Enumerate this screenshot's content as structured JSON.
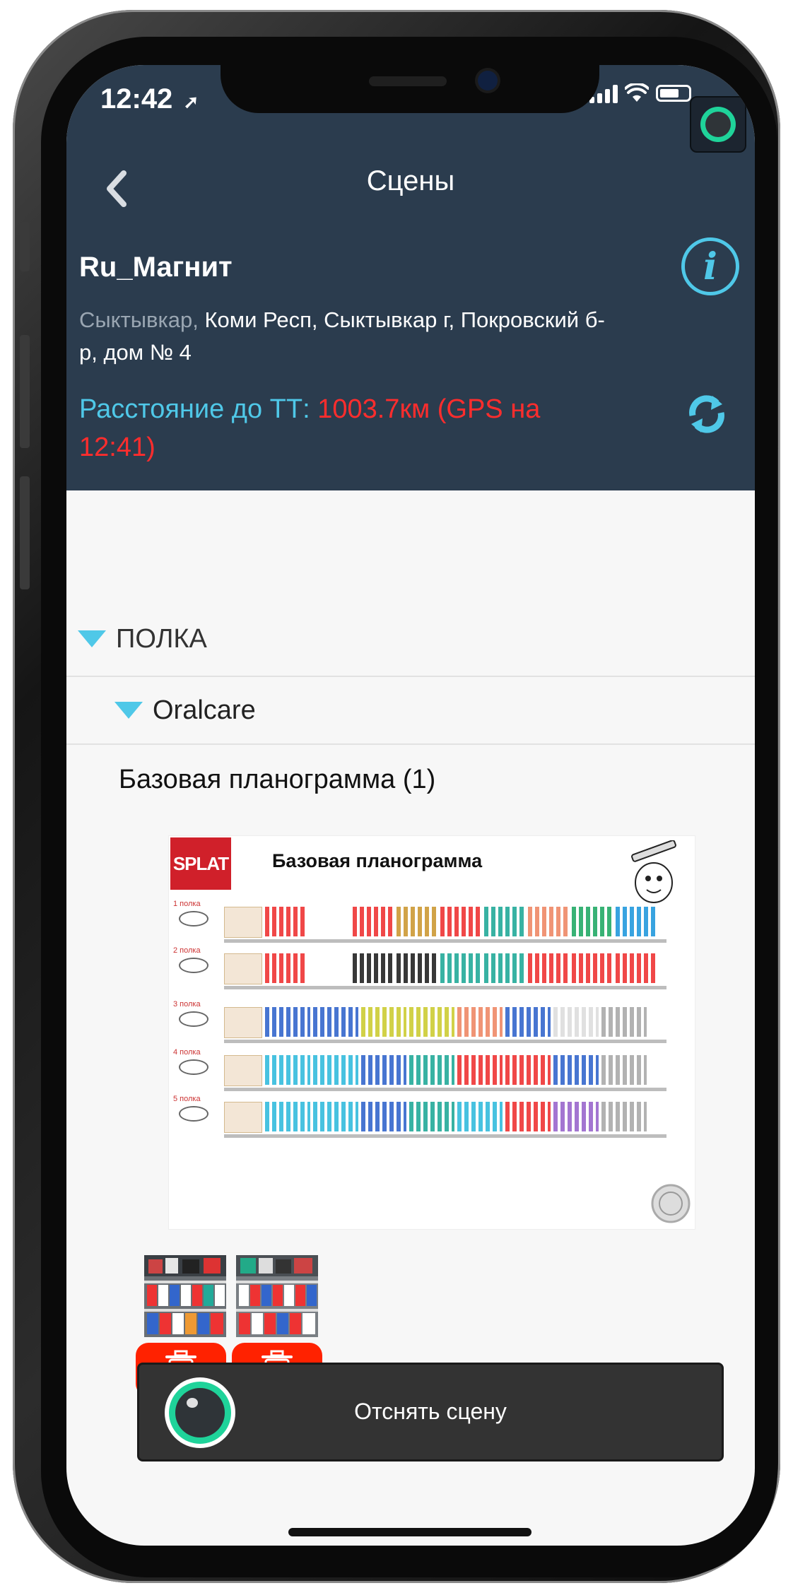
{
  "status_bar": {
    "time": "12:42",
    "location_arrow": "➚"
  },
  "nav": {
    "back_icon": "chevron-left-icon",
    "title": "Сцены"
  },
  "store": {
    "name": "Ru_Магнит",
    "address_muted": "Сыктывкар,",
    "address_main": " Коми Респ, Сыктывкар г, Покровский б-р, дом № 4",
    "distance_label": "Расстояние до ТТ: ",
    "distance_value": "1003.7км (GPS на 12:41)"
  },
  "tree": {
    "section": "ПОЛКА",
    "category": "Oralcare",
    "planogram_title": "Базовая планограмма (1)"
  },
  "planogram_image": {
    "brand": "SPLAT",
    "heading": "Базовая планограмма",
    "shelves": [
      "1 полка",
      "2 полка",
      "3 полка",
      "4 полка",
      "5 полка"
    ]
  },
  "photos": {
    "count": 2
  },
  "actions": {
    "shoot_scene": "Отснять сцену"
  },
  "colors": {
    "header_bg": "#2b3c4e",
    "accent_cyan": "#4fc8e8",
    "warning_red": "#ff2d2d",
    "delete_red": "#ff2200",
    "camera_green": "#1fd39a"
  }
}
